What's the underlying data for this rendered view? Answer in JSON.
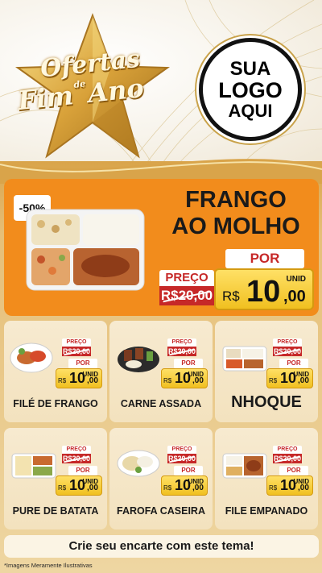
{
  "banner": {
    "title_line1": "Ofertas",
    "title_line2_a": "Fim",
    "title_line2_de": "de",
    "title_line2_b": "Ano",
    "logo": {
      "line1": "SUA",
      "line2": "LOGO",
      "line3": "AQUI"
    }
  },
  "featured": {
    "discount": "-50%",
    "name_line1": "FRANGO",
    "name_line2": "AO MOLHO",
    "preco_label": "PREÇO",
    "old_price": "R$20,00",
    "por_label": "POR",
    "unid_label": "UNID",
    "currency": "R$",
    "price_int": "10",
    "price_cents": ",00"
  },
  "products": [
    {
      "name": "FILÉ DE FRANGO",
      "preco_label": "PREÇO",
      "old_price": "R$20,00",
      "por_label": "POR",
      "unid_label": "UNID",
      "currency": "R$",
      "price_int": "10",
      "price_cents": ",00"
    },
    {
      "name": "CARNE ASSADA",
      "preco_label": "PREÇO",
      "old_price": "R$20,00",
      "por_label": "POR",
      "unid_label": "UNID",
      "currency": "R$",
      "price_int": "10",
      "price_cents": ",00"
    },
    {
      "name": "NHOQUE",
      "preco_label": "PREÇO",
      "old_price": "R$20,00",
      "por_label": "POR",
      "unid_label": "UNID",
      "currency": "R$",
      "price_int": "10",
      "price_cents": ",00"
    },
    {
      "name": "PURE DE BATATA",
      "preco_label": "PREÇO",
      "old_price": "R$20,00",
      "por_label": "POR",
      "unid_label": "UNID",
      "currency": "R$",
      "price_int": "10",
      "price_cents": ",00"
    },
    {
      "name": "FAROFA CASEIRA",
      "preco_label": "PREÇO",
      "old_price": "R$20,00",
      "por_label": "POR",
      "unid_label": "UNID",
      "currency": "R$",
      "price_int": "10",
      "price_cents": ",00"
    },
    {
      "name": "FILE EMPANADO",
      "preco_label": "PREÇO",
      "old_price": "R$20,00",
      "por_label": "POR",
      "unid_label": "UNID",
      "currency": "R$",
      "price_int": "10",
      "price_cents": ",00"
    }
  ],
  "cta": {
    "text": "Crie seu encarte com este tema!"
  },
  "footnote": "*Imagens Meramente Ilustrativas",
  "colors": {
    "accent_orange": "#f28c1c",
    "price_red": "#c62828",
    "price_yellow": "#f0c020",
    "gold": "#d9a44a"
  }
}
